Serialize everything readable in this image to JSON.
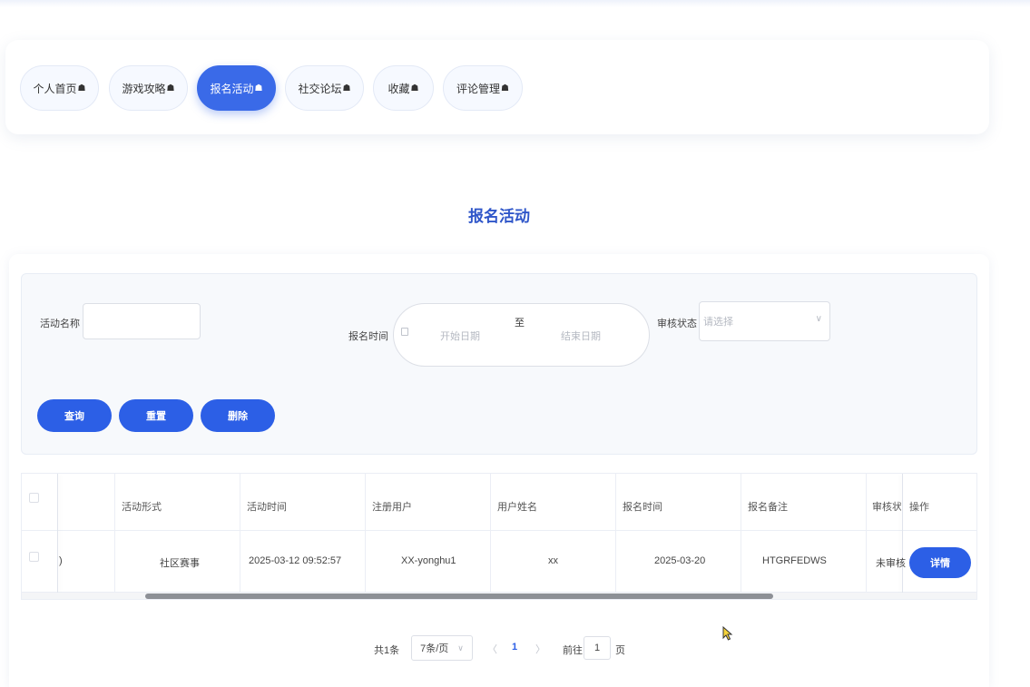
{
  "nav": {
    "tabs": [
      {
        "label": "个人首页"
      },
      {
        "label": "游戏攻略"
      },
      {
        "label": "报名活动"
      },
      {
        "label": "社交论坛"
      },
      {
        "label": "收藏"
      },
      {
        "label": "评论管理"
      }
    ],
    "active_index": 2,
    "hand_glyph": "☗"
  },
  "page": {
    "title": "报名活动"
  },
  "search": {
    "activity_name_label": "活动名称",
    "activity_name_value": "",
    "signup_time_label": "报名时间",
    "start_placeholder": "开始日期",
    "range_separator": "至",
    "end_placeholder": "结束日期",
    "review_status_label": "审核状态",
    "review_status_placeholder": "请选择",
    "select_arrow": "∨"
  },
  "buttons": {
    "query": "查询",
    "reset": "重置",
    "delete": "删除"
  },
  "table": {
    "headers": [
      "活动形式",
      "活动时间",
      "注册用户",
      "用户姓名",
      "报名时间",
      "报名备注",
      "审核状态",
      "操作"
    ],
    "rows": [
      {
        "partial_left": ")",
        "activity_form": "社区赛事",
        "activity_time": "2025-03-12 09:52:57",
        "registered_user": "XX-yonghu1",
        "user_name": "xx",
        "signup_time": "2025-03-20",
        "signup_note": "HTGRFEDWS",
        "review_status": "未审核",
        "action_label": "详情"
      }
    ]
  },
  "pagination": {
    "total": "共1条",
    "page_size": "7条/页",
    "page_size_arrow": "∨",
    "prev": "〈",
    "current_page": "1",
    "next": "〉",
    "goto_prefix": "前往",
    "goto_value": "1",
    "goto_suffix": "页"
  },
  "colors": {
    "accent": "#2c5fe6",
    "title": "#2f56c9"
  }
}
